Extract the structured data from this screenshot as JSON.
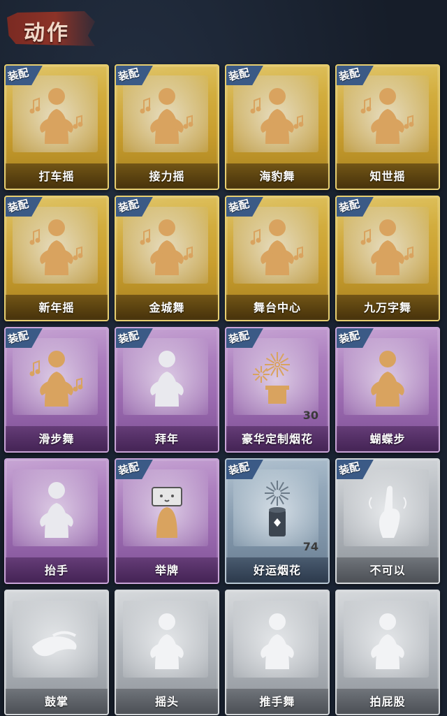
{
  "header": {
    "title": "动作"
  },
  "equip_badge": "装配",
  "cards": [
    {
      "label": "打车摇",
      "rarity": "gold",
      "equipped": true,
      "icon": "dance-figure-icon"
    },
    {
      "label": "接力摇",
      "rarity": "gold",
      "equipped": true,
      "icon": "dance-figure-icon"
    },
    {
      "label": "海豹舞",
      "rarity": "gold",
      "equipped": true,
      "icon": "dance-figure-icon"
    },
    {
      "label": "知世摇",
      "rarity": "gold",
      "equipped": true,
      "icon": "dance-figure-icon"
    },
    {
      "label": "新年摇",
      "rarity": "gold",
      "equipped": true,
      "icon": "dance-figure-icon"
    },
    {
      "label": "金城舞",
      "rarity": "gold",
      "equipped": true,
      "icon": "dance-figure-icon"
    },
    {
      "label": "舞台中心",
      "rarity": "gold",
      "equipped": true,
      "icon": "dance-figure-icon"
    },
    {
      "label": "九万字舞",
      "rarity": "gold",
      "equipped": true,
      "icon": "dance-figure-icon"
    },
    {
      "label": "滑步舞",
      "rarity": "purple",
      "equipped": true,
      "icon": "dance-figure-icon"
    },
    {
      "label": "拜年",
      "rarity": "purple",
      "equipped": true,
      "icon": "bow-figure-icon"
    },
    {
      "label": "豪华定制烟花",
      "rarity": "purple",
      "equipped": true,
      "icon": "fireworks-box-icon",
      "count": "30"
    },
    {
      "label": "蝴蝶步",
      "rarity": "purple",
      "equipped": true,
      "icon": "pointing-figure-icon"
    },
    {
      "label": "抬手",
      "rarity": "purple",
      "equipped": false,
      "icon": "raise-hand-figure-icon"
    },
    {
      "label": "举牌",
      "rarity": "purple",
      "equipped": true,
      "icon": "hold-sign-figure-icon"
    },
    {
      "label": "好运烟花",
      "rarity": "blue",
      "equipped": true,
      "icon": "firework-can-icon",
      "count": "74"
    },
    {
      "label": "不可以",
      "rarity": "gray",
      "equipped": true,
      "icon": "finger-wag-icon"
    },
    {
      "label": "鼓掌",
      "rarity": "gray",
      "equipped": false,
      "icon": "clap-hands-icon"
    },
    {
      "label": "摇头",
      "rarity": "gray",
      "equipped": false,
      "icon": "shake-head-figure-icon"
    },
    {
      "label": "推手舞",
      "rarity": "gray",
      "equipped": false,
      "icon": "push-hands-figure-icon"
    },
    {
      "label": "拍屁股",
      "rarity": "gray",
      "equipped": false,
      "icon": "slap-figure-icon"
    }
  ]
}
